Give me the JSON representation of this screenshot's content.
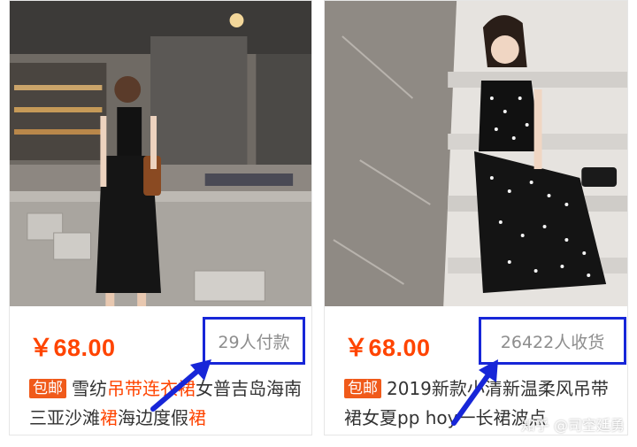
{
  "products": [
    {
      "price": "￥68.00",
      "sales": "29人付款",
      "tag": "包邮",
      "title_parts": [
        {
          "text": "雪纺",
          "hl": false
        },
        {
          "text": "吊带连衣裙",
          "hl": true
        },
        {
          "text": "女普吉岛海南三亚沙滩",
          "hl": false
        },
        {
          "text": "裙",
          "hl": true
        },
        {
          "text": "海边度假",
          "hl": false
        },
        {
          "text": "裙",
          "hl": true
        }
      ]
    },
    {
      "price": "￥68.00",
      "sales": "26422人收货",
      "tag": "包邮",
      "title_parts": [
        {
          "text": "2019新款小清新温柔风吊带裙女夏pp hoy一长裙波点",
          "hl": false
        }
      ]
    }
  ],
  "watermark": "知乎 @司空廷勇",
  "colors": {
    "price": "#ff4400",
    "tag_bg": "#f05a1a",
    "annotation": "#1726d8",
    "highlight": "#ff4400"
  }
}
